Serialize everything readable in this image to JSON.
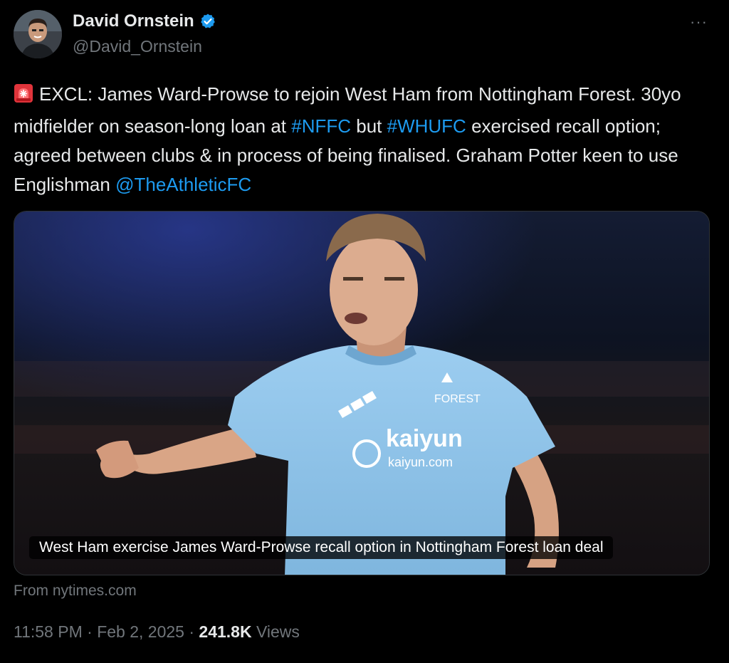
{
  "author": {
    "display_name": "David Ornstein",
    "handle": "@David_Ornstein",
    "avatar_icon": "person-avatar-icon",
    "verified_icon": "verified-badge-icon",
    "verified_color": "#1d9bf0"
  },
  "more_label": "···",
  "tweet": {
    "emoji_icon": "siren-emoji-icon",
    "text_1": "EXCL: James Ward-Prowse to rejoin West Ham from Nottingham Forest. 30yo midfielder on season-long loan at ",
    "hashtag_1": "#NFFC",
    "text_2": " but ",
    "hashtag_2": "#WHUFC",
    "text_3": " exercised recall option; agreed between clubs & in process of being finalised. Graham Potter keen to use Englishman ",
    "mention": "@TheAthleticFC"
  },
  "card": {
    "caption": "West Ham exercise James Ward-Prowse recall option in Nottingham Forest loan deal",
    "source": "From nytimes.com",
    "shirt_sponsor": "kaiyun",
    "shirt_sponsor_url": "kaiyun.com",
    "shirt_crest_text": "FOREST"
  },
  "meta": {
    "time": "11:58 PM",
    "separator": " · ",
    "date": "Feb 2, 2025",
    "separator_2": " · ",
    "views_count": "241.8K",
    "views_label": " Views"
  },
  "colors": {
    "background": "#000000",
    "text": "#e7e9ea",
    "secondary": "#71767b",
    "link": "#1d9bf0",
    "shirt": "#8ec3e8"
  }
}
